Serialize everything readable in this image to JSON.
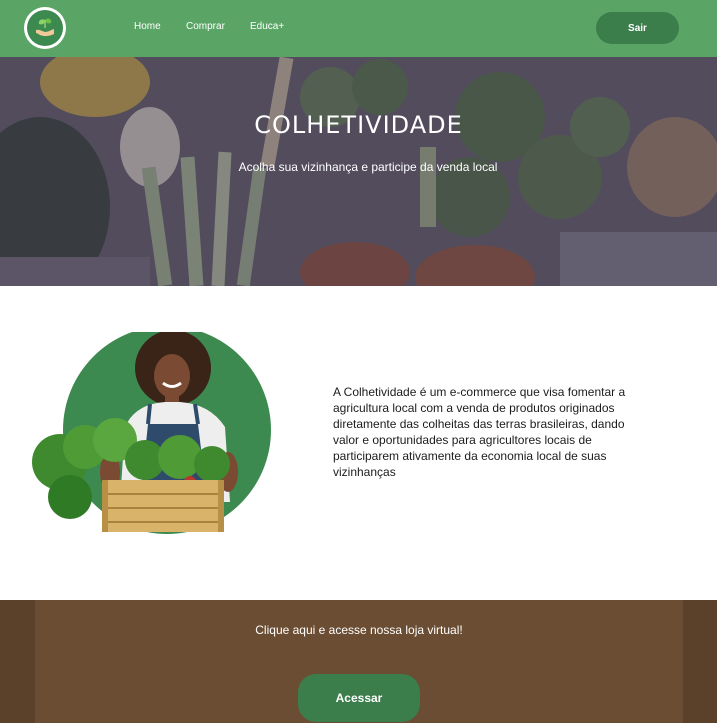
{
  "brand": {
    "logo_icon": "sprout-in-hand-icon"
  },
  "nav": {
    "home": "Home",
    "comprar": "Comprar",
    "educa": "Educa+",
    "logout": "Sair"
  },
  "hero": {
    "title": "COLHETIVIDADE",
    "subtitle": "Acolha sua vizinhança e participe da venda local"
  },
  "about": {
    "image": "farmer-with-vegetable-crate-photo",
    "text": "A Colhetividade é um e-commerce que visa fomentar a agricultura local com a venda de produtos originados diretamente das colheitas das terras brasileiras, dando valor e oportunidades para agricultores locais de participarem ativamente da economia local de suas vizinhanças"
  },
  "cta": {
    "text": "Clique aqui e acesse nossa loja virtual!",
    "button": "Acessar"
  },
  "colors": {
    "nav_green": "#5aa565",
    "button_green": "#3b7d4b",
    "cta_brown": "#6b4d33",
    "cta_brown_dark": "#5b402a"
  }
}
